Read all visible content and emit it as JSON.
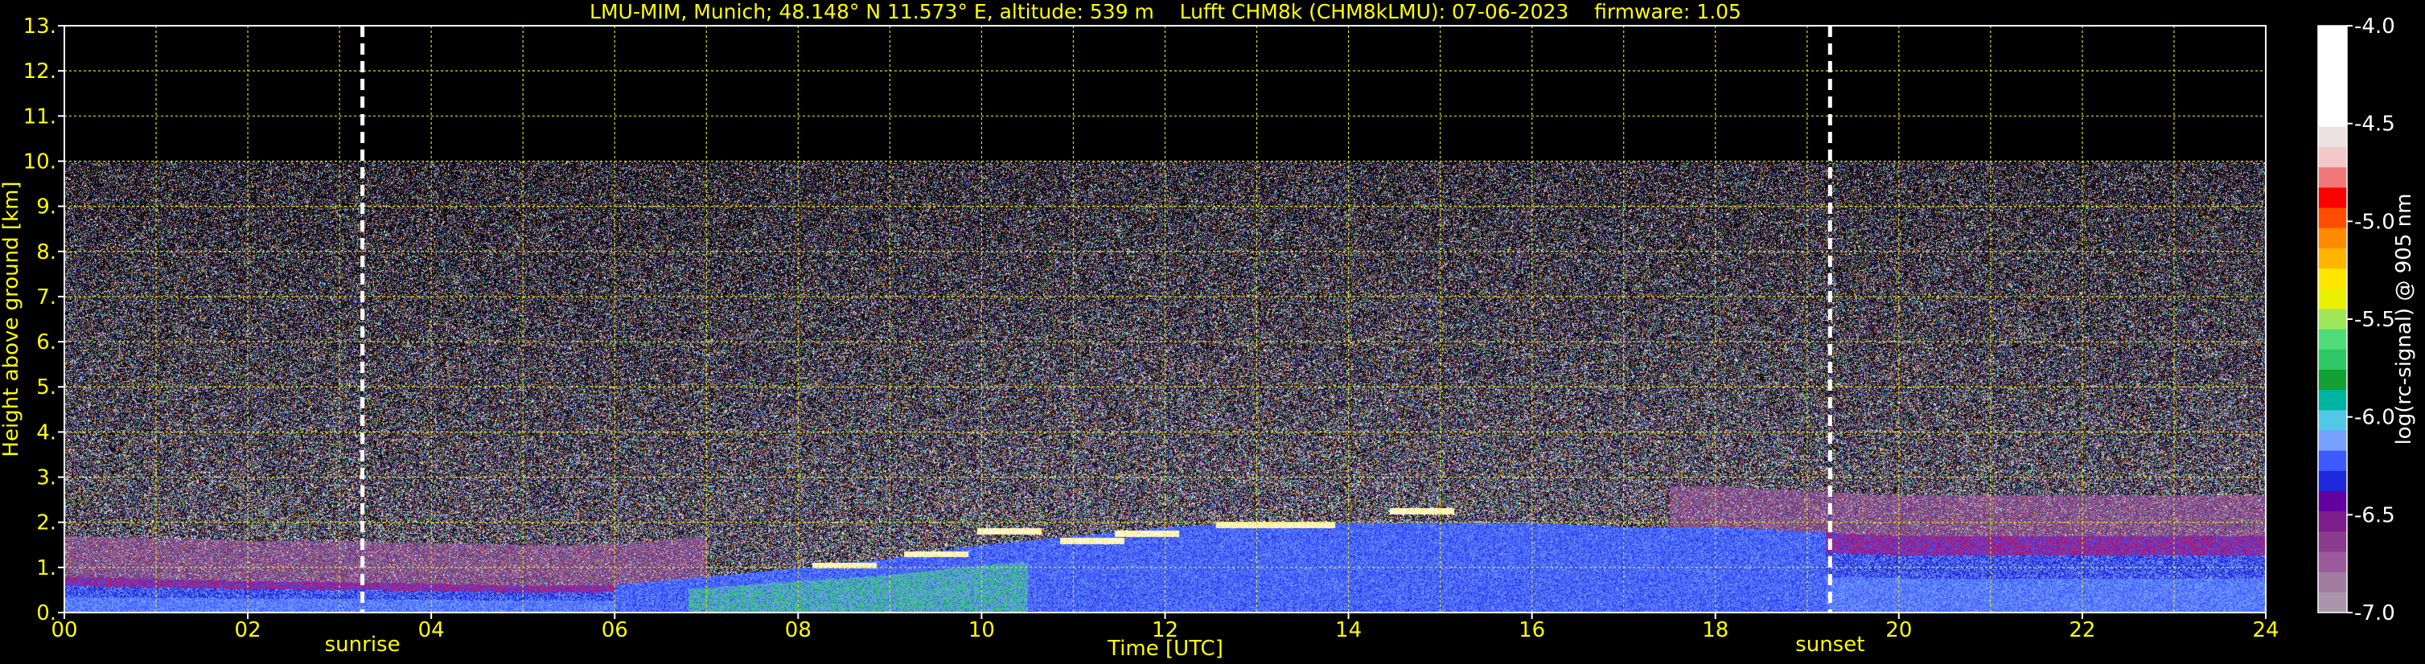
{
  "chart_data": {
    "type": "heatmap",
    "title": "LMU-MIM, Munich; 48.148° N 11.573° E, altitude: 539 m    Lufft CHM8k (CHM8kLMU): 07-06-2023    firmware: 1.05",
    "xlabel": "Time [UTC]",
    "ylabel": "Height above ground [km]",
    "xlim": [
      0,
      24
    ],
    "ylim": [
      0,
      13
    ],
    "x_ticks": [
      "00",
      "02",
      "04",
      "06",
      "08",
      "10",
      "12",
      "14",
      "16",
      "18",
      "20",
      "22",
      "24"
    ],
    "x_tick_values": [
      0,
      2,
      4,
      6,
      8,
      10,
      12,
      14,
      16,
      18,
      20,
      22,
      24
    ],
    "y_ticks": [
      "0.",
      "1.",
      "2.",
      "3.",
      "4.",
      "5.",
      "6.",
      "7.",
      "8.",
      "9.",
      "10.",
      "11.",
      "12.",
      "13."
    ],
    "y_tick_values": [
      0,
      1,
      2,
      3,
      4,
      5,
      6,
      7,
      8,
      9,
      10,
      11,
      12,
      13
    ],
    "grid": true,
    "data_top_km": 10,
    "events": [
      {
        "label": "sunrise",
        "x": 3.25
      },
      {
        "label": "sunset",
        "x": 19.25
      }
    ],
    "boundary_layer": [
      [
        0,
        0.8
      ],
      [
        1,
        0.75
      ],
      [
        2,
        0.7
      ],
      [
        3,
        0.68
      ],
      [
        4,
        0.65
      ],
      [
        5,
        0.6
      ],
      [
        6,
        0.62
      ],
      [
        7,
        0.8
      ],
      [
        8,
        1.0
      ],
      [
        9,
        1.2
      ],
      [
        10,
        1.5
      ],
      [
        11,
        1.7
      ],
      [
        12,
        1.9
      ],
      [
        13,
        2.0
      ],
      [
        14,
        2.0
      ],
      [
        15,
        2.0
      ],
      [
        16,
        2.0
      ],
      [
        17,
        1.9
      ],
      [
        18,
        1.9
      ],
      [
        19,
        1.8
      ],
      [
        20,
        1.7
      ],
      [
        21,
        1.7
      ],
      [
        22,
        1.7
      ],
      [
        23,
        1.7
      ],
      [
        24,
        1.7
      ]
    ],
    "cloud_tops": [
      [
        8.5,
        1.05
      ],
      [
        9.5,
        1.3
      ],
      [
        10.3,
        1.8
      ],
      [
        11.2,
        1.6
      ],
      [
        11.8,
        1.75
      ],
      [
        12.9,
        1.95
      ],
      [
        13.5,
        1.95
      ],
      [
        14.8,
        2.25
      ]
    ],
    "colorbar": {
      "label": "log(rc-signal) @ 905 nm",
      "range": [
        -7.0,
        -4.0
      ],
      "ticks": [
        "-4.0",
        "-4.5",
        "-5.0",
        "-5.5",
        "-6.0",
        "-6.5",
        "-7.0"
      ],
      "tick_values": [
        -4.0,
        -4.5,
        -5.0,
        -5.5,
        -6.0,
        -6.5,
        -7.0
      ],
      "colors": [
        "#ffffff",
        "#ffffff",
        "#ffffff",
        "#ffffff",
        "#ffffff",
        "#ebe1e1",
        "#f2c8c8",
        "#f07878",
        "#ff0000",
        "#ff4d00",
        "#ff8c00",
        "#ffb400",
        "#ffe600",
        "#ebf000",
        "#a0e65a",
        "#50dc78",
        "#2dc864",
        "#14a032",
        "#00b4a0",
        "#50c8e6",
        "#78a0ff",
        "#3c5aff",
        "#1e28dc",
        "#6400a0",
        "#7d1e8c",
        "#8c3c8c",
        "#9b5a9b",
        "#a07da0",
        "#aa96aa"
      ]
    }
  }
}
